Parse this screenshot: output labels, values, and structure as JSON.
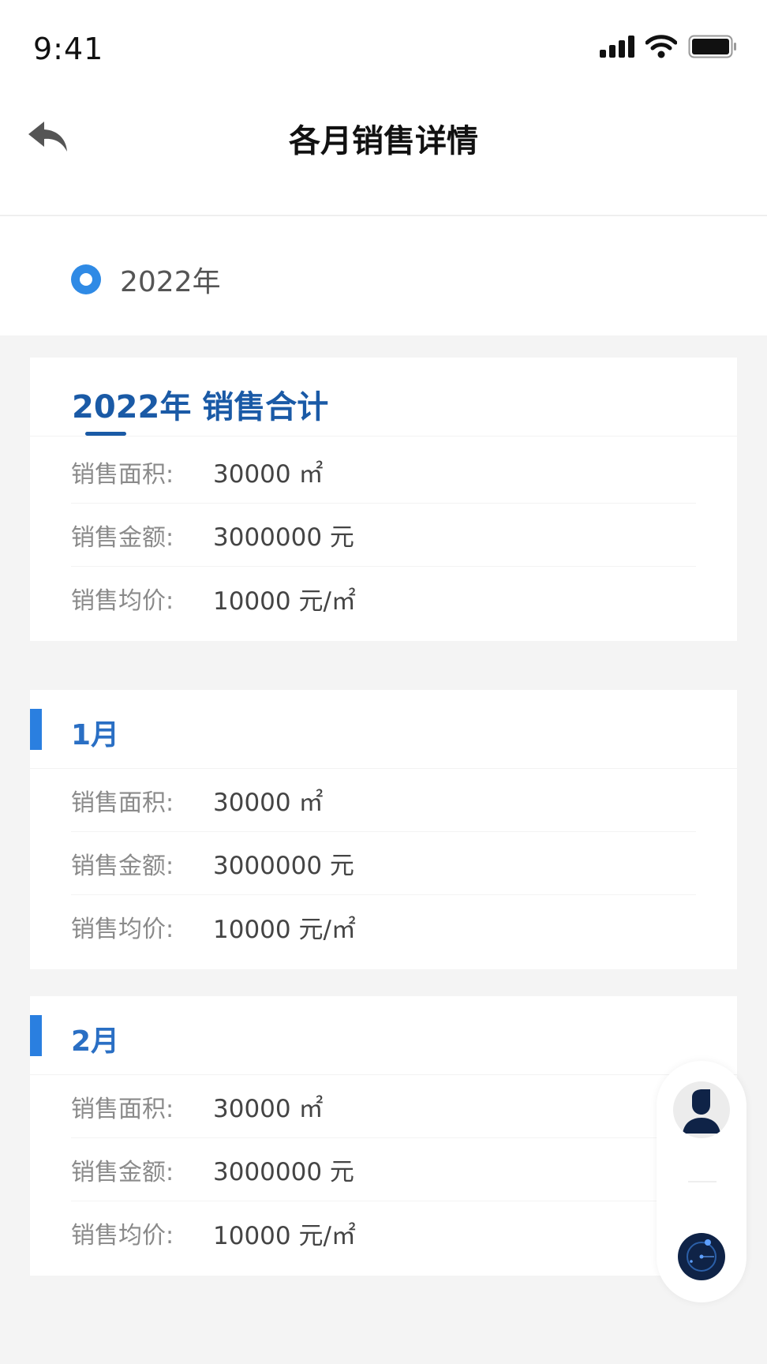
{
  "status_bar": {
    "time": "9:41"
  },
  "nav": {
    "title": "各月销售详情",
    "back_icon": "back-arrow-icon"
  },
  "year_selector": {
    "label": "2022年",
    "selected": true,
    "accent": "#2f8ae5"
  },
  "summary": {
    "title": "2022年 销售合计",
    "rows": [
      {
        "label": "销售面积:",
        "value": "30000 ㎡"
      },
      {
        "label": "销售金额:",
        "value": "3000000 元"
      },
      {
        "label": "销售均价:",
        "value": "10000 元/㎡"
      }
    ]
  },
  "months": [
    {
      "title": "1月",
      "rows": [
        {
          "label": "销售面积:",
          "value": "30000 ㎡"
        },
        {
          "label": "销售金额:",
          "value": "3000000 元"
        },
        {
          "label": "销售均价:",
          "value": "10000 元/㎡"
        }
      ]
    },
    {
      "title": "2月",
      "rows": [
        {
          "label": "销售面积:",
          "value": "30000 ㎡"
        },
        {
          "label": "销售金额:",
          "value": "3000000 元"
        },
        {
          "label": "销售均价:",
          "value": "10000 元/㎡"
        }
      ]
    }
  ],
  "float_panel": {
    "top_icon": "user-avatar-icon",
    "bottom_icon": "radar-icon"
  },
  "colors": {
    "primary_blue": "#1a5aa6",
    "month_accent": "#2a7fe0",
    "background": "#f4f4f4"
  }
}
